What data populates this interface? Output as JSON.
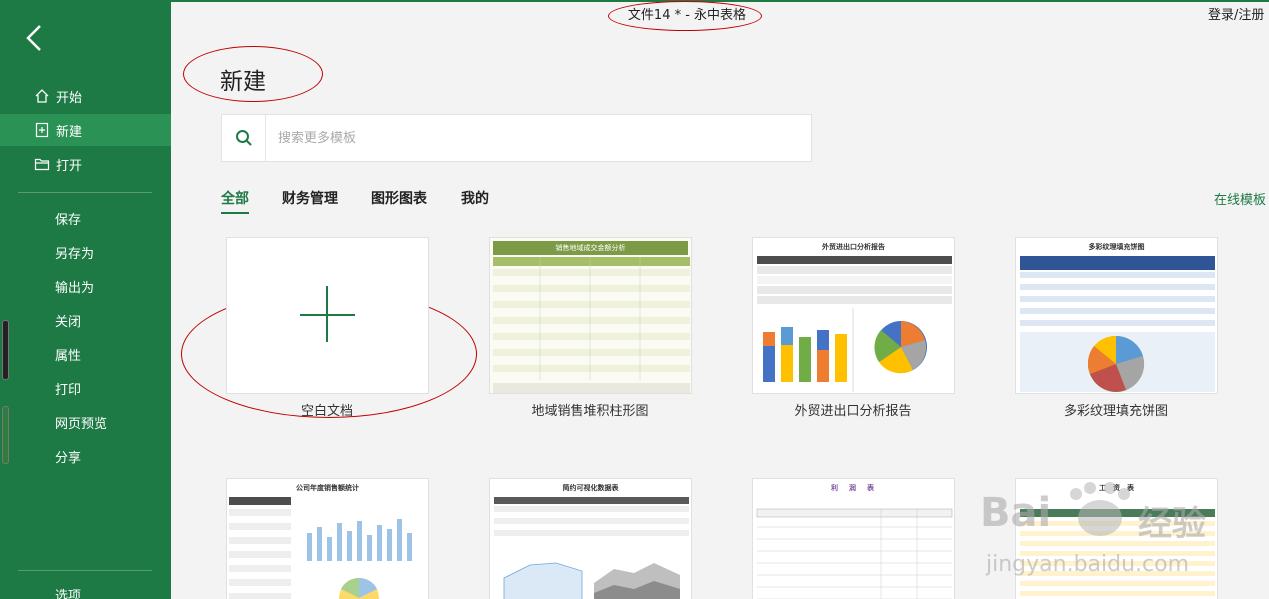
{
  "window": {
    "title": "文件14 *  - 永中表格",
    "login_label": "登录/注册"
  },
  "sidebar": {
    "items": [
      {
        "label": "开始",
        "icon": "home-icon"
      },
      {
        "label": "新建",
        "icon": "new-file-icon",
        "active": true
      },
      {
        "label": "打开",
        "icon": "folder-icon"
      },
      {
        "label": "保存"
      },
      {
        "label": "另存为"
      },
      {
        "label": "输出为"
      },
      {
        "label": "关闭"
      },
      {
        "label": "属性"
      },
      {
        "label": "打印"
      },
      {
        "label": "网页预览"
      },
      {
        "label": "分享"
      },
      {
        "label": "选项"
      }
    ]
  },
  "main": {
    "heading": "新建",
    "search": {
      "placeholder": "搜索更多模板"
    },
    "tabs": [
      {
        "label": "全部",
        "active": true
      },
      {
        "label": "财务管理"
      },
      {
        "label": "图形图表"
      },
      {
        "label": "我的"
      }
    ],
    "online_templates": "在线模板",
    "templates": [
      {
        "label": "空白文档"
      },
      {
        "label": "地域销售堆积柱形图",
        "thumb_title": "销售地域成交金额分析"
      },
      {
        "label": "外贸进出口分析报告",
        "thumb_title": "外贸进出口分析报告"
      },
      {
        "label": "多彩纹理填充饼图",
        "thumb_title": "多彩纹理填充饼图"
      },
      {
        "label": "",
        "thumb_title": "公司年度销售额统计"
      },
      {
        "label": "",
        "thumb_title": "简约可视化数据表"
      },
      {
        "label": "",
        "thumb_title": "利　润　表"
      },
      {
        "label": "",
        "thumb_title": "工　资　表"
      }
    ]
  },
  "watermark": {
    "brand": "Bai",
    "brand2": "经验",
    "url": "jingyan.baidu.com"
  },
  "colors": {
    "accent": "#1e7a45",
    "annotation": "#c00000"
  }
}
